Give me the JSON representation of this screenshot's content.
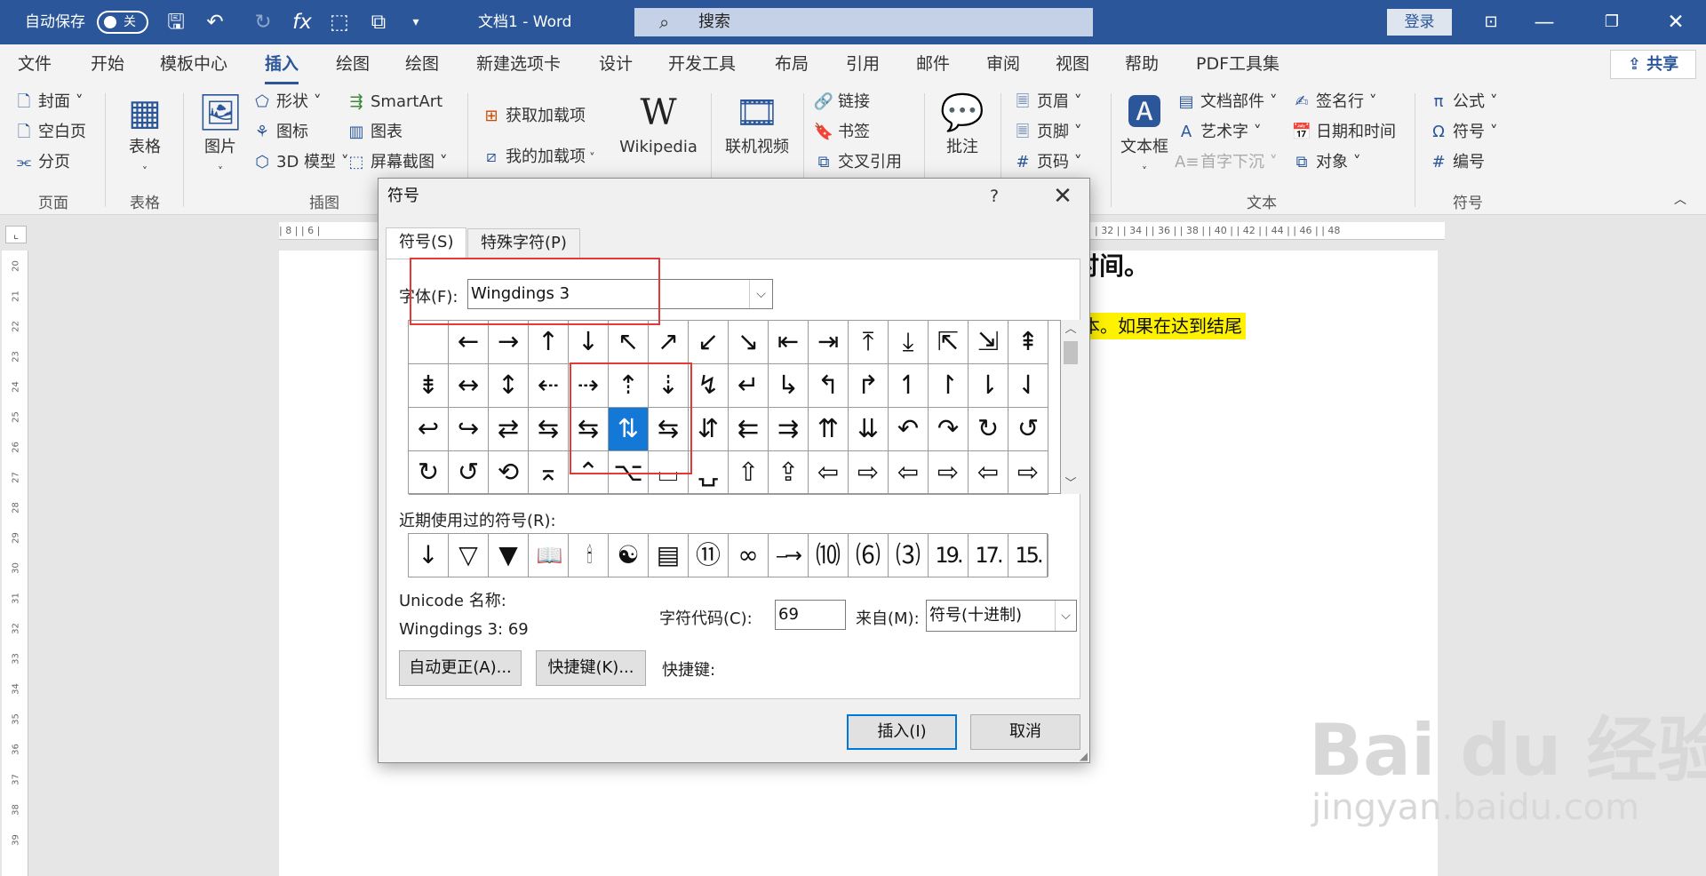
{
  "titlebar": {
    "autosave": "自动保存",
    "toggle": "关",
    "title": "文档1  -  Word",
    "search": "搜索",
    "login": "登录"
  },
  "menus": [
    "文件",
    "开始",
    "模板中心",
    "插入",
    "绘图",
    "绘图",
    "新建选项卡",
    "设计",
    "开发工具",
    "布局",
    "引用",
    "邮件",
    "审阅",
    "视图",
    "帮助",
    "PDF工具集"
  ],
  "share": "共享",
  "ribbon": {
    "page_group": {
      "items": [
        "封面 ˅",
        "空白页",
        "分页"
      ],
      "label": "页面"
    },
    "table_group": {
      "item": "表格",
      "label": "表格"
    },
    "illus_group": {
      "picture": "图片",
      "items": [
        "形状 ˅",
        "图标",
        "3D 模型 ˅",
        "SmartArt",
        "图表",
        "屏幕截图 ˅"
      ],
      "label": "插图"
    },
    "addin_group": {
      "items": [
        "获取加载项",
        "我的加载项"
      ],
      "wiki": "Wikipedia"
    },
    "media": {
      "item": "联机视频"
    },
    "links": {
      "items": [
        "链接",
        "书签",
        "交叉引用"
      ]
    },
    "comment": {
      "item": "批注"
    },
    "header": {
      "items": [
        "页眉 ˅",
        "页脚 ˅",
        "页码 ˅"
      ]
    },
    "text_group": {
      "textbox": "文本框",
      "items": [
        "文档部件 ˅",
        "艺术字 ˅",
        "首字下沉 ˅",
        "签名行 ˅",
        "日期和时间",
        "对象 ˅"
      ],
      "label": "文本"
    },
    "symbol_group": {
      "items": [
        "公式 ˅",
        "符号 ˅",
        "编号"
      ],
      "label": "符号"
    }
  },
  "ruler_h": "| 8 |   | 6 |",
  "ruler_h_right": "| 32 |   | 34 |   | 36 |   | 38 |   | 40 |   | 42 |   | 44 |   | 46 |   | 48",
  "ruler_v": [
    "20",
    "21",
    "22",
    "23",
    "24",
    "25",
    "26",
    "27",
    "28",
    "29",
    "30",
    "31",
    "32",
    "33",
    "34",
    "35",
    "36",
    "37",
    "38",
    "39"
  ],
  "doc": {
    "heading": "时间。",
    "highlight": "本。如果在达到结尾"
  },
  "dialog": {
    "title": "符号",
    "help": "?",
    "tabs": [
      "符号(S)",
      "特殊字符(P)"
    ],
    "font_label": "字体(F):",
    "font_value": "Wingdings 3",
    "grid": [
      [
        "",
        " ←",
        "→",
        "↑",
        "↓",
        "↖",
        "↗",
        "↙",
        "↘",
        "⇤",
        "⇥",
        "⤒",
        "⤓",
        "⇱",
        "⇲",
        "⇞"
      ],
      [
        "⇟",
        "↔",
        "↕",
        "⇠",
        "⇢",
        "⇡",
        "⇣",
        "↯",
        "↵",
        "↳",
        "↰",
        "↱",
        "↿",
        "↾",
        "⇂",
        "⇃"
      ],
      [
        "↩",
        "↪",
        "⇄",
        "⇆",
        "⇆",
        "⇅",
        "⇆",
        "⇵",
        "⇇",
        "⇉",
        "⇈",
        "⇊",
        "↶",
        "↷",
        "↻",
        "↺"
      ],
      [
        "↻",
        "↺",
        "⟲",
        "⌅",
        "⌃",
        "⌥",
        "⌴",
        "⍽",
        "⇧",
        "⇪",
        "⇦",
        "⇨",
        "⇦",
        "⇨",
        "⇦",
        "⇨"
      ]
    ],
    "selected": [
      2,
      5
    ],
    "recent_label": "近期使用过的符号(R):",
    "recent": [
      "↓",
      "▽",
      "▼",
      "📖",
      "🕯",
      "☯",
      "▤",
      "⑪",
      "∞",
      "⎯→",
      "⑽",
      "⑹",
      "⑶",
      "19.",
      "17.",
      "15."
    ],
    "unicode_label": "Unicode 名称:",
    "unicode_value": "Wingdings 3: 69",
    "code_label": "字符代码(C):",
    "code_value": "69",
    "from_label": "来自(M):",
    "from_value": "符号(十进制)",
    "autocorrect": "自动更正(A)...",
    "shortcut_btn": "快捷键(K)...",
    "shortcut_label": "快捷键:",
    "insert": "插入(I)",
    "cancel": "取消"
  },
  "watermark": {
    "logo": "Bai du 经验",
    "url": "jingyan.baidu.com"
  }
}
